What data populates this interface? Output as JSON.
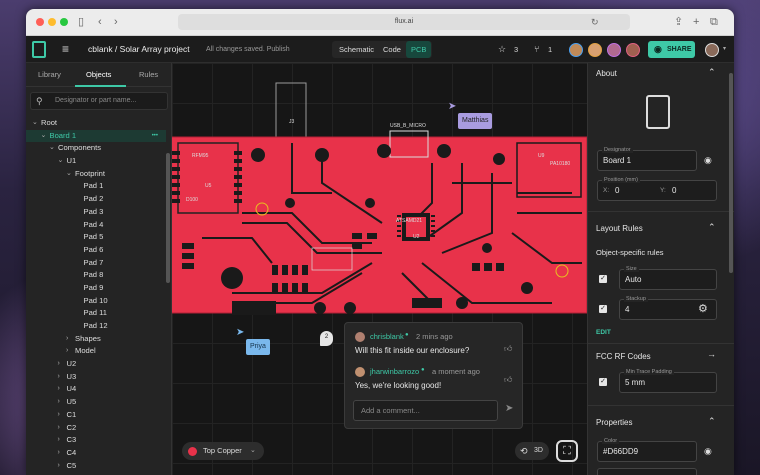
{
  "browser": {
    "url": "flux.ai"
  },
  "app": {
    "project_title": "cblank / Solar Array project",
    "save_status": "All changes saved. Publish",
    "view_tabs": [
      "Schematic",
      "Code",
      "PCB"
    ],
    "active_view": "PCB",
    "star_count": "3",
    "fork_count": "1",
    "share_label": "SHARE"
  },
  "left_panel": {
    "tabs": [
      "Library",
      "Objects",
      "Rules"
    ],
    "active_tab": "Objects",
    "search_placeholder": "Designator or part name...",
    "tree": [
      {
        "label": "Root",
        "level": 0,
        "arrow": "⌄"
      },
      {
        "label": "Board 1",
        "level": 1,
        "arrow": "⌄",
        "selected": true
      },
      {
        "label": "Components",
        "level": 2,
        "arrow": "⌄"
      },
      {
        "label": "U1",
        "level": 3,
        "arrow": "⌄"
      },
      {
        "label": "Footprint",
        "level": 4,
        "arrow": "⌄"
      },
      {
        "label": "Pad 1",
        "level": 5,
        "arrow": ""
      },
      {
        "label": "Pad 2",
        "level": 5,
        "arrow": ""
      },
      {
        "label": "Pad 3",
        "level": 5,
        "arrow": ""
      },
      {
        "label": "Pad 4",
        "level": 5,
        "arrow": ""
      },
      {
        "label": "Pad 5",
        "level": 5,
        "arrow": ""
      },
      {
        "label": "Pad 6",
        "level": 5,
        "arrow": ""
      },
      {
        "label": "Pad 7",
        "level": 5,
        "arrow": ""
      },
      {
        "label": "Pad 8",
        "level": 5,
        "arrow": ""
      },
      {
        "label": "Pad 9",
        "level": 5,
        "arrow": ""
      },
      {
        "label": "Pad 10",
        "level": 5,
        "arrow": ""
      },
      {
        "label": "Pad 11",
        "level": 5,
        "arrow": ""
      },
      {
        "label": "Pad 12",
        "level": 5,
        "arrow": ""
      },
      {
        "label": "Shapes",
        "level": 4,
        "arrow": "›"
      },
      {
        "label": "Model",
        "level": 4,
        "arrow": "›"
      },
      {
        "label": "U2",
        "level": 3,
        "arrow": "›"
      },
      {
        "label": "U3",
        "level": 3,
        "arrow": "›"
      },
      {
        "label": "U4",
        "level": 3,
        "arrow": "›"
      },
      {
        "label": "U5",
        "level": 3,
        "arrow": "›"
      },
      {
        "label": "C1",
        "level": 3,
        "arrow": "›"
      },
      {
        "label": "C2",
        "level": 3,
        "arrow": "›"
      },
      {
        "label": "C3",
        "level": 3,
        "arrow": "›"
      },
      {
        "label": "C4",
        "level": 3,
        "arrow": "›"
      },
      {
        "label": "C5",
        "level": 3,
        "arrow": "›"
      }
    ]
  },
  "canvas": {
    "labels": {
      "j3": "J3",
      "usb": "USB_B_MICRO",
      "rfm95": "RFM95",
      "u5": "U5",
      "u2": "U2",
      "u9": "U9",
      "pa": "PA10180",
      "samd": "ATSAMD21",
      "d100": "D100"
    },
    "cursors": [
      {
        "name": "Matthias",
        "color": "#a99ce0"
      },
      {
        "name": "Priya",
        "color": "#7ab8ec"
      }
    ],
    "comment_pin": "2",
    "layer_label": "Top Copper",
    "view_3d": "3D",
    "board_color": "#e8324a",
    "trace_color": "#1a1a1a"
  },
  "comment": {
    "messages": [
      {
        "author": "chrisblank",
        "time": "2 mins ago",
        "text": "Will this fit inside our enclosure?"
      },
      {
        "author": "jharwinbarrozo",
        "time": "a moment ago",
        "text": "Yes, we're looking good!"
      }
    ],
    "placeholder": "Add a comment..."
  },
  "right_panel": {
    "about": {
      "title": "About",
      "designator_label": "Designator",
      "designator": "Board 1",
      "position_label": "Position (mm)",
      "x_label": "X:",
      "x": "0",
      "y_label": "Y:",
      "y": "0"
    },
    "layout_rules": {
      "title": "Layout Rules",
      "subtitle": "Object-specific rules",
      "size_label": "Size",
      "size": "Auto",
      "stackup_label": "Stackup",
      "stackup": "4",
      "edit": "EDIT"
    },
    "fcc": {
      "title": "FCC RF Codes",
      "mtp_label": "Min Trace Padding",
      "mtp": "5 mm"
    },
    "properties": {
      "title": "Properties",
      "color_label": "Color",
      "color": "#D66DD9"
    }
  },
  "colors": {
    "accent": "#3ec9a7",
    "pcb_red": "#e8324a",
    "panel": "#242424"
  }
}
